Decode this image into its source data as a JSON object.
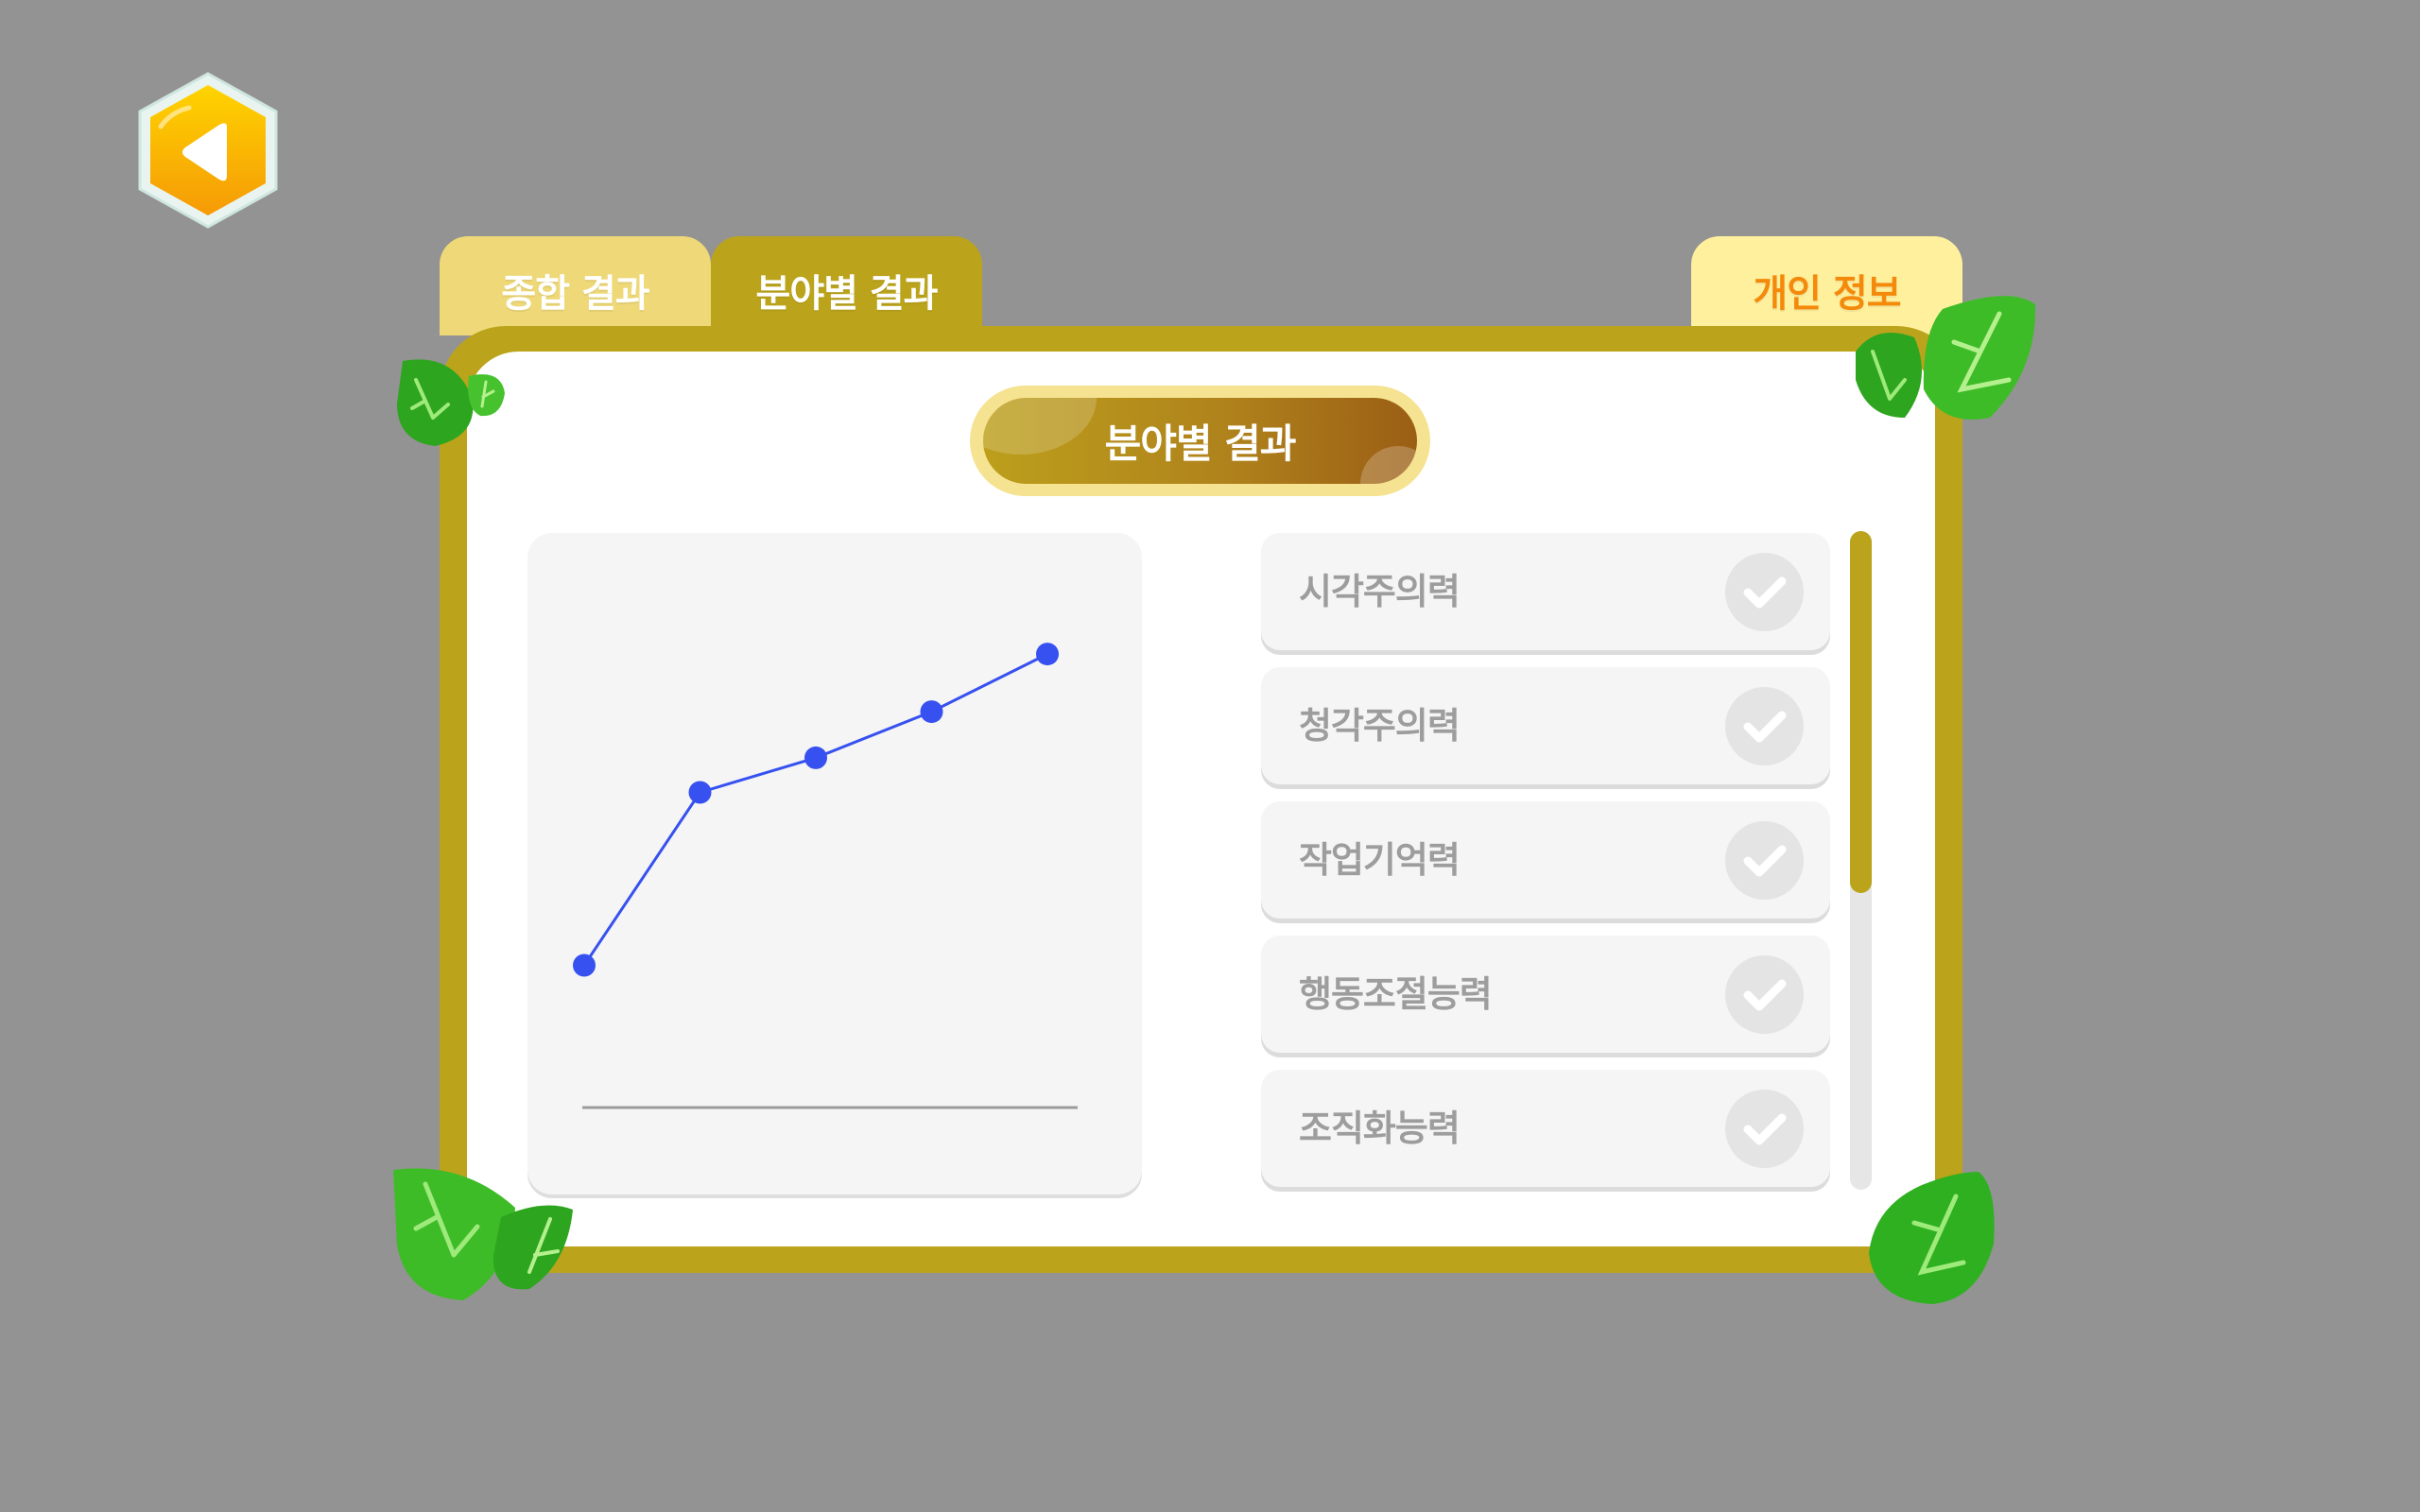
{
  "back_button": {
    "icon": "back-arrow-icon"
  },
  "tabs": [
    {
      "label": "종합 결과",
      "active": false
    },
    {
      "label": "분야별 결과",
      "active": true
    },
    {
      "label": "개인 정보",
      "active": false
    }
  ],
  "panel": {
    "title": "분야별 결과"
  },
  "chart_data": {
    "type": "line",
    "title": "",
    "xlabel": "",
    "ylabel": "",
    "x": [
      1,
      2,
      3,
      4,
      5
    ],
    "values": [
      25,
      55,
      61,
      69,
      79
    ],
    "ylim": [
      0,
      100
    ],
    "grid": false,
    "series_color": "#3651f0"
  },
  "categories": [
    {
      "label": "시각주의력",
      "selected": true
    },
    {
      "label": "청각주의력",
      "selected": false
    },
    {
      "label": "작업기억력",
      "selected": false
    },
    {
      "label": "행동조절능력",
      "selected": false
    },
    {
      "label": "조직화능력",
      "selected": false
    }
  ],
  "scroll": {
    "position_fraction": 0.0,
    "visible_fraction": 0.55
  },
  "colors": {
    "background": "#939393",
    "frame": "#bba41b",
    "accent_orange": "#f48a0c",
    "selected_item": "#fff1a5",
    "check_selected": "#fbb103",
    "leaf": "#2fb021"
  }
}
